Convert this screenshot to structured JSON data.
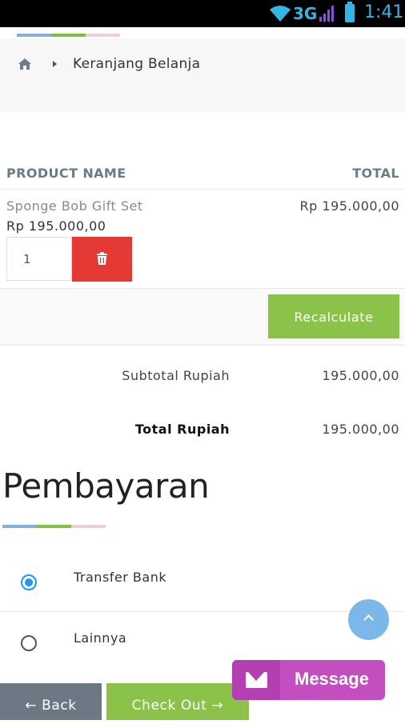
{
  "status_bar": {
    "network": "3G",
    "time": "1:41"
  },
  "breadcrumb": {
    "home_icon": "home-icon",
    "current": "Keranjang Belanja"
  },
  "cart": {
    "columns": {
      "product": "PRODUCT NAME",
      "total": "TOTAL"
    },
    "items": [
      {
        "name": "Sponge Bob Gift Set",
        "price": "Rp 195.000,00",
        "total": "Rp 195.000,00",
        "quantity": "1"
      }
    ],
    "recalculate_label": "Recalculate",
    "subtotal_label": "Subtotal Rupiah",
    "subtotal_value": "195.000,00",
    "total_label": "Total Rupiah",
    "total_value": "195.000,00"
  },
  "payment": {
    "title": "Pembayaran",
    "options": [
      {
        "label": "Transfer Bank",
        "selected": true
      },
      {
        "label": "Lainnya",
        "selected": false
      }
    ]
  },
  "footer": {
    "back_label": "← Back",
    "checkout_label": "Check Out →",
    "message_label": "Message"
  },
  "colors": {
    "accent_green": "#8bc34a",
    "danger_red": "#e53935",
    "back_gray": "#6d7885",
    "message_purple": "#c34ec0",
    "radio_blue": "#2196f3"
  }
}
